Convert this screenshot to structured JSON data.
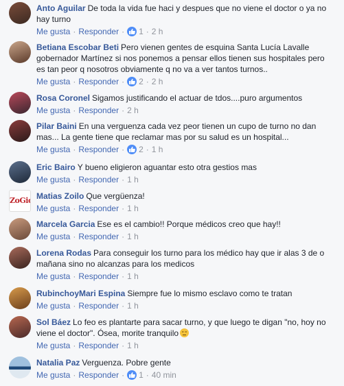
{
  "labels": {
    "like": "Me gusta",
    "reply": "Responder",
    "dot": "·"
  },
  "colors": {
    "author": "#365899",
    "action": "#4267b2",
    "meta": "#90949c",
    "like_badge": "#4f8df7",
    "background": "#f6f7f9"
  },
  "comments": [
    {
      "author": "Anto Aguilar",
      "text": "De toda la vida fue haci y despues que no viene el doctor o ya no hay turno",
      "likes": "1",
      "time": "2 h",
      "avatar": "user-avatar"
    },
    {
      "author": "Betiana Escobar Beti",
      "text": "Pero vienen gentes de esquina Santa Lucía Lavalle gobernador Martínez si nos ponemos a pensar ellos tienen sus hospitales pero es tan peor q nosotros obviamente q no va a ver tantos turnos..",
      "likes": "2",
      "time": "2 h",
      "avatar": "user-avatar"
    },
    {
      "author": "Rosa Coronel",
      "text": "Sigamos justificando el actuar de tdos....puro argumentos",
      "likes": "",
      "time": "2 h",
      "avatar": "user-avatar"
    },
    {
      "author": "Pilar Baini",
      "text": "En una verguenza cada vez peor tienen un cupo de turno no dan mas... La gente tiene que reclamar mas por su salud es un hospital...",
      "likes": "2",
      "time": "1 h",
      "avatar": "user-avatar"
    },
    {
      "author": "Eric Bairo",
      "text": "Y bueno eligieron aguantar esto otra gestios mas",
      "likes": "",
      "time": "1 h",
      "avatar": "user-avatar"
    },
    {
      "author": "Matias Zoilo",
      "text": "Que vergüenza!",
      "likes": "",
      "time": "1 h",
      "avatar": "zogio-logo",
      "avatar_text": "ZoGio"
    },
    {
      "author": "Marcela Garcia",
      "text": "Ese es el cambio!! Porque médicos creo que hay!!",
      "likes": "",
      "time": "1 h",
      "avatar": "user-avatar"
    },
    {
      "author": "Lorena Rodas",
      "text": "Para conseguir los turno para los médico hay que ir alas 3 de o mañana sino no alcanzas para los medicos",
      "likes": "",
      "time": "1 h",
      "avatar": "user-avatar"
    },
    {
      "author": "RubinchoyMari Espina",
      "text": "Siempre fue lo mismo esclavo como te tratan",
      "likes": "",
      "time": "1 h",
      "avatar": "user-avatar"
    },
    {
      "author": "Sol Báez",
      "text": "Lo feo es plantarte para sacar turno, y que luego te digan \"no, hoy no viene el doctor\". Ósea, morite tranquilo",
      "emoji": "unamused-emoji",
      "likes": "",
      "time": "1 h",
      "avatar": "user-avatar"
    },
    {
      "author": "Natalia Paz",
      "text": "Verguenza. Pobre gente",
      "likes": "1",
      "time": "40 min",
      "avatar": "user-avatar"
    }
  ]
}
